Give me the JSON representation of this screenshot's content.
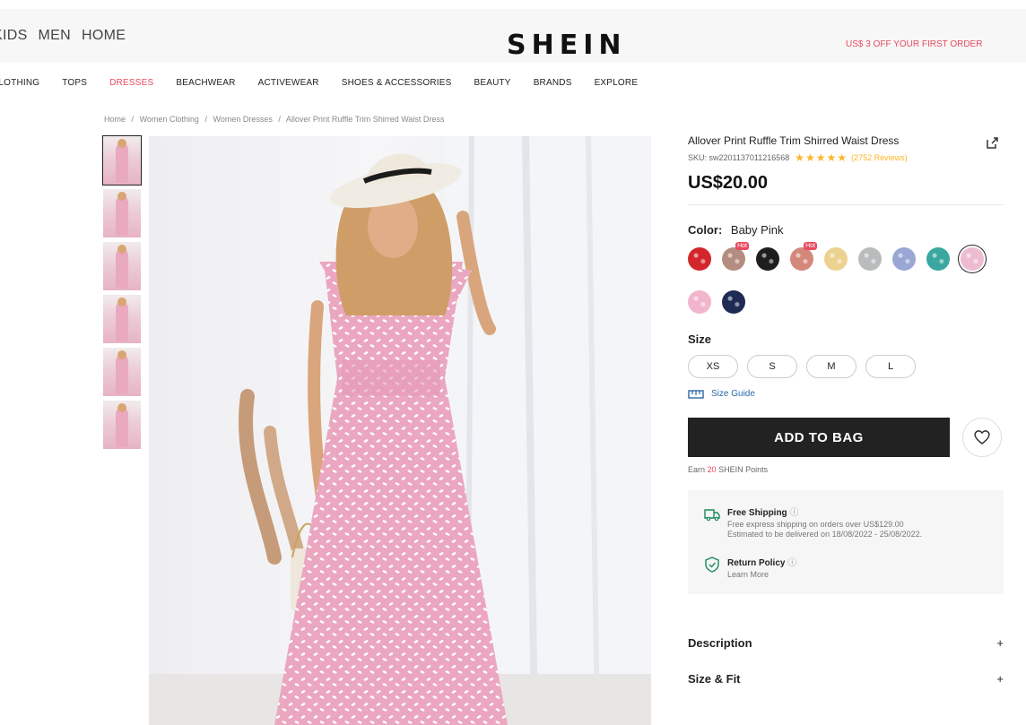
{
  "header": {
    "top_nav": [
      "KIDS",
      "MEN",
      "HOME"
    ],
    "logo": "SHEIN",
    "promo": "US$ 3 OFF YOUR FIRST ORDER"
  },
  "category_nav": {
    "items": [
      "CLOTHING",
      "TOPS",
      "DRESSES",
      "BEACHWEAR",
      "ACTIVEWEAR",
      "SHOES & ACCESSORIES",
      "BEAUTY",
      "BRANDS",
      "EXPLORE"
    ],
    "active": "DRESSES",
    "accent_color": "#e8495d"
  },
  "breadcrumb": [
    "Home",
    "/",
    "Women Clothing",
    "/",
    "Women Dresses",
    "/",
    "Allover Print Ruffle Trim Shirred Waist Dress"
  ],
  "product": {
    "title": "Allover Print Ruffle Trim Shirred Waist Dress",
    "sku": "SKU: sw2201137011216568",
    "rating_stars": "★★★★★",
    "rating": 4.5,
    "reviews": "(2752 Reviews)",
    "price": "US$20.00",
    "color_label": "Color:",
    "color_value": "Baby Pink",
    "swatches": [
      {
        "color": "#d3262c",
        "hot": false
      },
      {
        "color": "#b38d7f",
        "hot": true,
        "hot_label": "Hot"
      },
      {
        "color": "#1e1e1e",
        "hot": false
      },
      {
        "color": "#d4887c",
        "hot": true,
        "hot_label": "Hot"
      },
      {
        "color": "#ecd28f",
        "hot": false
      },
      {
        "color": "#b9bcbc",
        "hot": false
      },
      {
        "color": "#9aa7d4",
        "hot": false
      },
      {
        "color": "#3aa7a0",
        "hot": false
      },
      {
        "color": "#edbcd0",
        "hot": false,
        "selected": true
      },
      {
        "color": "#f2b6cc",
        "hot": false
      },
      {
        "color": "#1f2b55",
        "hot": false
      }
    ],
    "size_label": "Size",
    "sizes": [
      "XS",
      "S",
      "M",
      "L"
    ],
    "size_guide": "Size Guide",
    "add_to_bag": "ADD TO BAG",
    "points_prefix": "Earn",
    "points_value": "20",
    "points_suffix": "SHEIN Points",
    "shipping": {
      "title": "Free Shipping",
      "line1": "Free express shipping on orders over US$129.00",
      "line2": "Estimated to be delivered on 18/08/2022 - 25/08/2022."
    },
    "return_policy": {
      "title": "Return Policy",
      "link": "Learn More"
    },
    "accordions": [
      {
        "label": "Description",
        "icon": "+"
      },
      {
        "label": "Size & Fit",
        "icon": "+"
      }
    ]
  }
}
